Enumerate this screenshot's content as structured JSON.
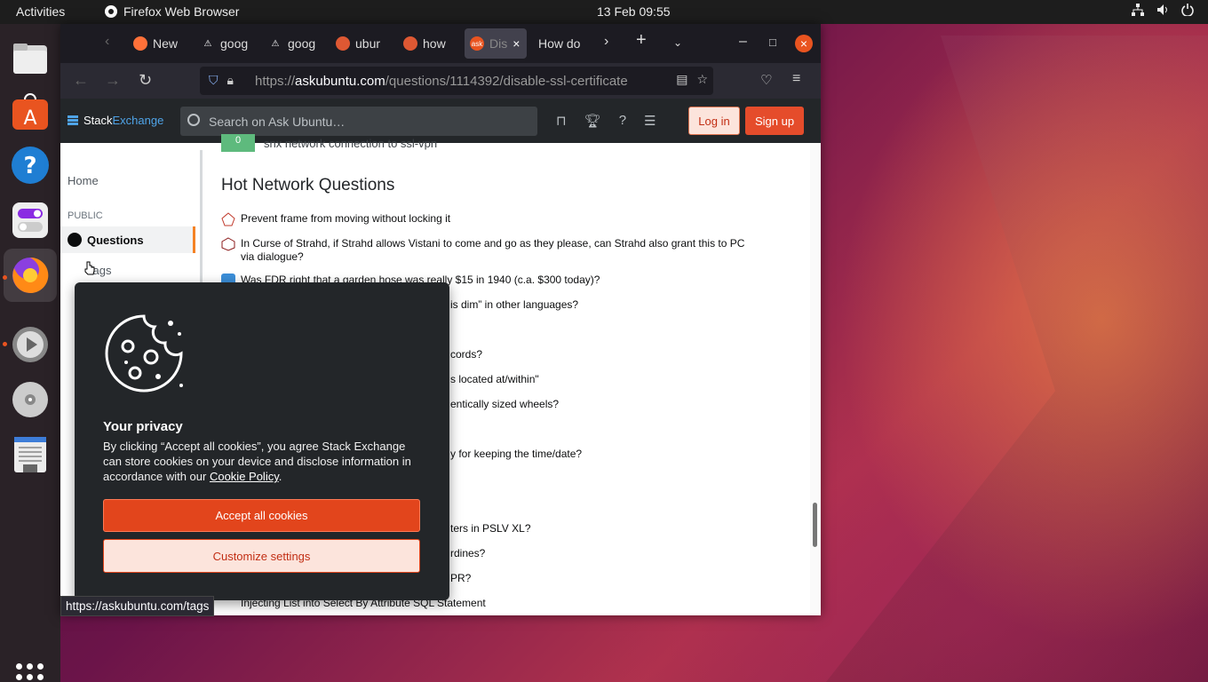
{
  "topbar": {
    "activities": "Activities",
    "app_name": "Firefox Web Browser",
    "clock": "13 Feb  09:55"
  },
  "dock": {
    "items": [
      "files",
      "app-center",
      "help",
      "settings-toggle",
      "firefox",
      "rhythmbox",
      "dvd",
      "text-editor"
    ]
  },
  "browser": {
    "tabs": [
      {
        "label": "New",
        "icon": "firefox-icon"
      },
      {
        "label": "goog",
        "icon": "warning-icon"
      },
      {
        "label": "goog",
        "icon": "warning-icon"
      },
      {
        "label": "ubur",
        "icon": "duckduckgo-icon"
      },
      {
        "label": "how",
        "icon": "duckduckgo-icon"
      },
      {
        "label": "Dis",
        "icon": "askubuntu-icon",
        "selected": true
      },
      {
        "label": "How do",
        "icon": ""
      }
    ],
    "url_prefix": "https://",
    "url_host": "askubuntu.com",
    "url_path": "/questions/1114392/disable-ssl-certificate"
  },
  "site": {
    "logo_stack": "Stack",
    "logo_exchange": "Exchange",
    "search_placeholder": "Search on Ask Ubuntu…",
    "login": "Log in",
    "signup": "Sign up"
  },
  "leftnav": {
    "home": "Home",
    "public": "PUBLIC",
    "questions": "Questions",
    "tags": "Tags"
  },
  "main": {
    "prev_vote": "0",
    "prev_text": "snx network connection to ssl-vpn",
    "hnq_title": "Hot Network Questions",
    "hnq_items": [
      "Prevent frame from moving without locking it",
      "In Curse of Strahd, if Strahd allows Vistani to come and go as they please, can Strahd also grant this to PC via dialogue?",
      "Was FDR right that a garden hose was really $15 in 1940 (c.a. $300 today)?",
      "is dim” in other languages?",
      "cords?",
      "s located at/within\"",
      "entically sized wheels?",
      "y for keeping the time/date?",
      "ters in PSLV XL?",
      "rdines?",
      "PR?",
      "Injecting List into Select By Attribute SQL Statement"
    ]
  },
  "cookie": {
    "title": "Your privacy",
    "body": "By clicking “Accept all cookies”, you agree Stack Exchange can store cookies on your device and disclose information in accordance with our ",
    "link": "Cookie Policy",
    "period": ".",
    "accept": "Accept all cookies",
    "customize": "Customize settings"
  },
  "statusbar": {
    "url": "https://askubuntu.com/tags"
  },
  "colors": {
    "accent": "#e95420",
    "se_orange": "#f48225",
    "se_dark": "#232629"
  }
}
